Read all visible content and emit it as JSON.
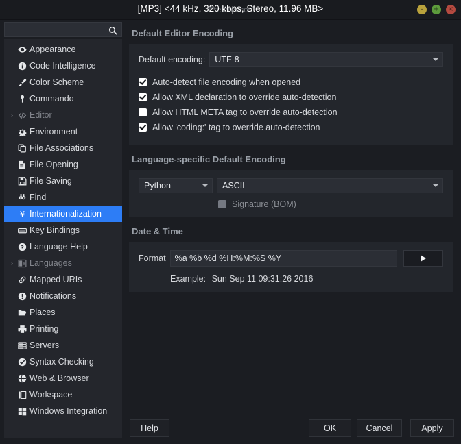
{
  "titlebar": {
    "window_title": "Preferences",
    "document_title": "[MP3] <44 kHz, 320 kbps, Stereo, 11.96 MB>",
    "buttons": {
      "minimize": "minimize-button",
      "maximize": "maximize-button",
      "close": "close-button"
    }
  },
  "sidebar": {
    "search": {
      "value": "",
      "placeholder": ""
    },
    "items": [
      {
        "label": "Appearance",
        "icon": "eye-icon",
        "state": "normal",
        "twisty": ""
      },
      {
        "label": "Code Intelligence",
        "icon": "info-circle-icon",
        "state": "normal",
        "twisty": ""
      },
      {
        "label": "Color Scheme",
        "icon": "brush-icon",
        "state": "normal",
        "twisty": ""
      },
      {
        "label": "Commando",
        "icon": "pin-icon",
        "state": "normal",
        "twisty": ""
      },
      {
        "label": "Editor",
        "icon": "code-tags-icon",
        "state": "dim",
        "twisty": "›"
      },
      {
        "label": "Environment",
        "icon": "gear-icon",
        "state": "normal",
        "twisty": ""
      },
      {
        "label": "File Associations",
        "icon": "copy-files-icon",
        "state": "normal",
        "twisty": ""
      },
      {
        "label": "File Opening",
        "icon": "document-icon",
        "state": "normal",
        "twisty": ""
      },
      {
        "label": "File Saving",
        "icon": "floppy-disk-icon",
        "state": "normal",
        "twisty": ""
      },
      {
        "label": "Find",
        "icon": "binoculars-icon",
        "state": "normal",
        "twisty": ""
      },
      {
        "label": "Internationalization",
        "icon": "yen-icon",
        "state": "selected",
        "twisty": ""
      },
      {
        "label": "Key Bindings",
        "icon": "keyboard-icon",
        "state": "normal",
        "twisty": ""
      },
      {
        "label": "Language Help",
        "icon": "question-circle-icon",
        "state": "normal",
        "twisty": ""
      },
      {
        "label": "Languages",
        "icon": "languages-icon",
        "state": "dim",
        "twisty": "›"
      },
      {
        "label": "Mapped URIs",
        "icon": "link-icon",
        "state": "normal",
        "twisty": ""
      },
      {
        "label": "Notifications",
        "icon": "exclamation-circle-icon",
        "state": "normal",
        "twisty": ""
      },
      {
        "label": "Places",
        "icon": "folder-open-icon",
        "state": "normal",
        "twisty": ""
      },
      {
        "label": "Printing",
        "icon": "printer-icon",
        "state": "normal",
        "twisty": ""
      },
      {
        "label": "Servers",
        "icon": "server-stack-icon",
        "state": "normal",
        "twisty": ""
      },
      {
        "label": "Syntax Checking",
        "icon": "check-circle-icon",
        "state": "normal",
        "twisty": ""
      },
      {
        "label": "Web & Browser",
        "icon": "globe-icon",
        "state": "normal",
        "twisty": ""
      },
      {
        "label": "Workspace",
        "icon": "window-panes-icon",
        "state": "normal",
        "twisty": ""
      },
      {
        "label": "Windows Integration",
        "icon": "windows-logo-icon",
        "state": "normal",
        "twisty": ""
      }
    ]
  },
  "main": {
    "default_encoding_section": {
      "title": "Default Editor Encoding",
      "encoding_label": "Default encoding:",
      "encoding_value": "UTF-8",
      "checkboxes": [
        {
          "label": "Auto-detect file encoding when opened",
          "checked": true
        },
        {
          "label": "Allow XML declaration to override auto-detection",
          "checked": true
        },
        {
          "label": "Allow HTML META tag to override auto-detection",
          "checked": false
        },
        {
          "label": "Allow 'coding:' tag to override auto-detection",
          "checked": true
        }
      ]
    },
    "language_specific_section": {
      "title": "Language-specific Default Encoding",
      "language_value": "Python",
      "encoding_value": "ASCII",
      "bom_label": "Signature (BOM)",
      "bom_checked": false,
      "bom_disabled": true
    },
    "datetime_section": {
      "title": "Date & Time",
      "format_label": "Format",
      "format_value": "%a %b %d %H:%M:%S %Y",
      "preview_button": "play-icon",
      "example_label": "Example:",
      "example_value": "Sun Sep 11 09:31:26 2016"
    }
  },
  "footer": {
    "help": "Help",
    "help_mnemonic": "H",
    "help_rest": "elp",
    "ok": "OK",
    "cancel": "Cancel",
    "apply": "Apply"
  },
  "colors": {
    "window_bg": "#1b1d22",
    "panel_bg": "#23262c",
    "sidebar_bg": "#24262c",
    "selection": "#2d7df6",
    "section_header": "#9aa0a8",
    "text": "#d8dade"
  }
}
